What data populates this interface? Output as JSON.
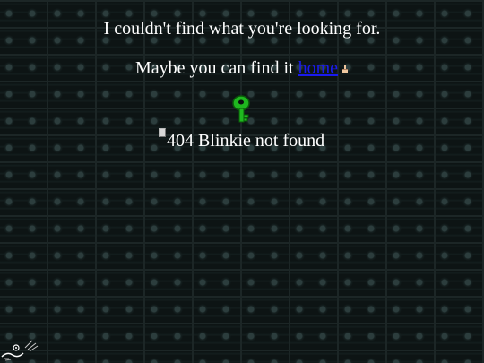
{
  "messages": {
    "line1": "I couldn't find what you're looking for.",
    "line2_prefix": "Maybe you can find it ",
    "home_link": "home"
  },
  "blinkie": {
    "alt_text": "404 Blinkie not found"
  },
  "icons": {
    "pointer": "pointing-hand-icon",
    "key": "green-key-icon",
    "cat": "cat-icon",
    "broken_image": "broken-image-icon"
  },
  "colors": {
    "link": "#1a1aee",
    "text": "#ffffff",
    "key": "#1fb81f"
  }
}
